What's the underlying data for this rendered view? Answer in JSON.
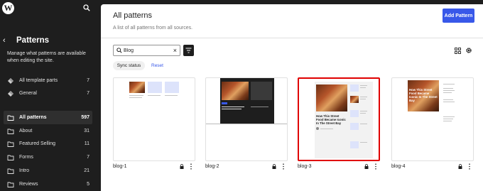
{
  "sidebar": {
    "back_arrow": "‹",
    "title": "Patterns",
    "description": "Manage what patterns are available when editing the site.",
    "top_items": [
      {
        "label": "All template parts",
        "count": "7"
      },
      {
        "label": "General",
        "count": "7"
      }
    ],
    "items": [
      {
        "label": "All patterns",
        "count": "597"
      },
      {
        "label": "About",
        "count": "31"
      },
      {
        "label": "Featured Selling",
        "count": "11"
      },
      {
        "label": "Forms",
        "count": "7"
      },
      {
        "label": "Intro",
        "count": "21"
      },
      {
        "label": "Reviews",
        "count": "5"
      }
    ],
    "icons": {
      "logo": "wordpress-logo",
      "search": "search-icon",
      "part": "diamond-icon",
      "folder": "folder-icon"
    }
  },
  "header": {
    "title": "All patterns",
    "subtitle": "A list of all patterns from all sources.",
    "add_button": "Add Pattern"
  },
  "toolbar": {
    "search_value": "Blog",
    "clear": "×",
    "sync_status": "Sync status",
    "reset": "Reset"
  },
  "cards": [
    {
      "name": "blog-1",
      "selected": false
    },
    {
      "name": "blog-2",
      "selected": false
    },
    {
      "name": "blog-3",
      "selected": true
    },
    {
      "name": "blog-4",
      "selected": false
    }
  ],
  "thumb_text": {
    "blog3_heading": "How This Street Food Became Iconic In The Street Bay",
    "blog4_heading": "How This Street Food Became Iconic In The Street Bay"
  },
  "colors": {
    "accent": "#3858e9",
    "sidebar_bg": "#1e1e1e",
    "selection": "#e00000"
  }
}
